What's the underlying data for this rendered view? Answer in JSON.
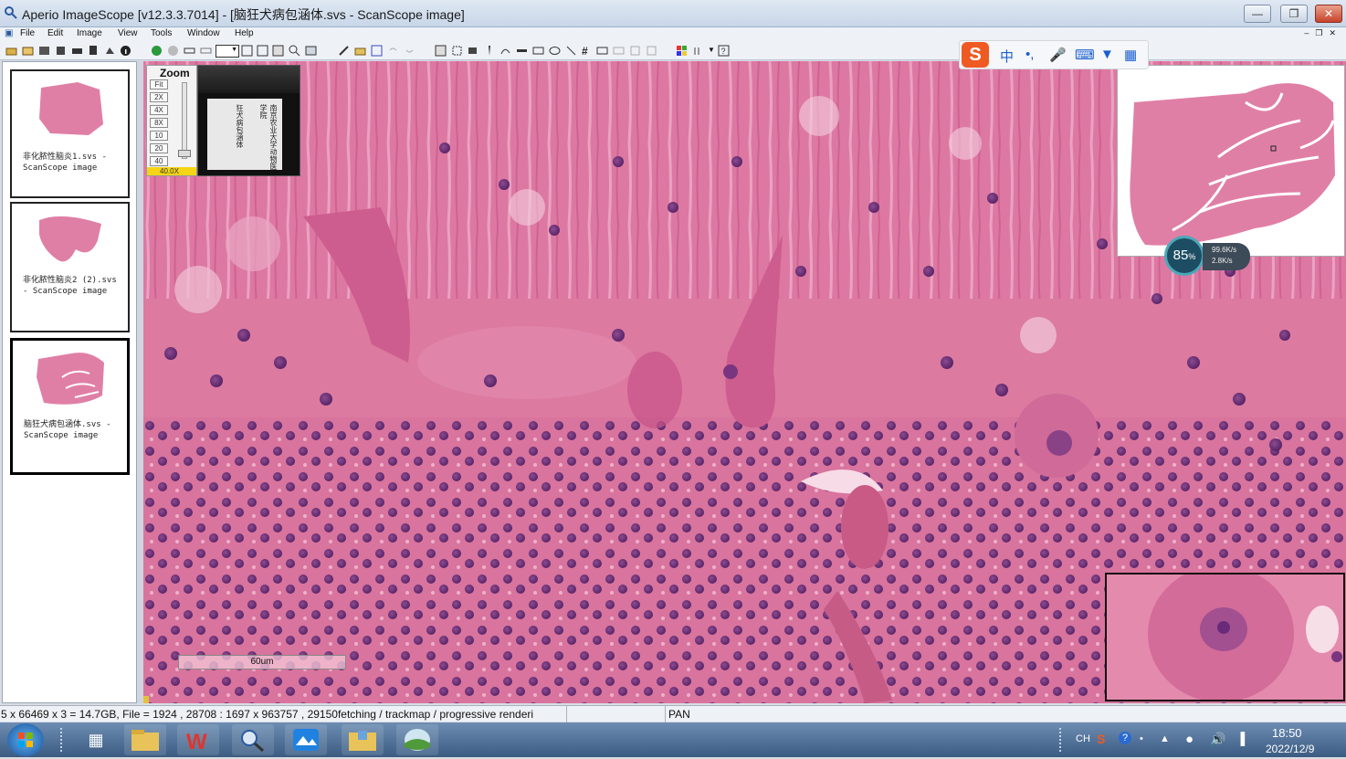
{
  "window": {
    "title": "Aperio ImageScope [v12.3.3.7014] - [脑狂犬病包涵体.svs - ScanScope image]"
  },
  "menu": [
    "File",
    "Edit",
    "Image",
    "View",
    "Tools",
    "Window",
    "Help"
  ],
  "sidebar": {
    "items": [
      {
        "label": "非化脓性脑炎1.svs - ScanScope image"
      },
      {
        "label": "非化脓性脑炎2 (2).svs - ScanScope image"
      },
      {
        "label": "脑狂犬病包涵体.svs - ScanScope image"
      }
    ]
  },
  "zoom": {
    "title": "Zoom",
    "buttons": [
      "Fit",
      "2X",
      "4X",
      "8X",
      "10",
      "20",
      "40"
    ],
    "current": "40.0X"
  },
  "label_panel": {
    "text1": "狂犬病包涵体",
    "text2": "南京农业大学动物医学院"
  },
  "scalebar": {
    "label": "60um"
  },
  "network_widget": {
    "percent": "85",
    "up": "99.6K/s",
    "down": "2.8K/s"
  },
  "ime": {
    "zhong": "中"
  },
  "statusbar": {
    "info": "5 x 66469 x 3 = 14.7GB, File = 1924 , 28708 : 1697 x 963757 , 29150fetching / trackmap / progressive renderi",
    "mode": "PAN"
  },
  "taskbar": {
    "tray_lang": "CH",
    "time": "18:50",
    "date": "2022/12/9"
  },
  "colors": {
    "tissue_pink": "#dc7aa0",
    "nucleus_purple": "#6a2a7a",
    "zoom_highlight": "#f5d516"
  }
}
